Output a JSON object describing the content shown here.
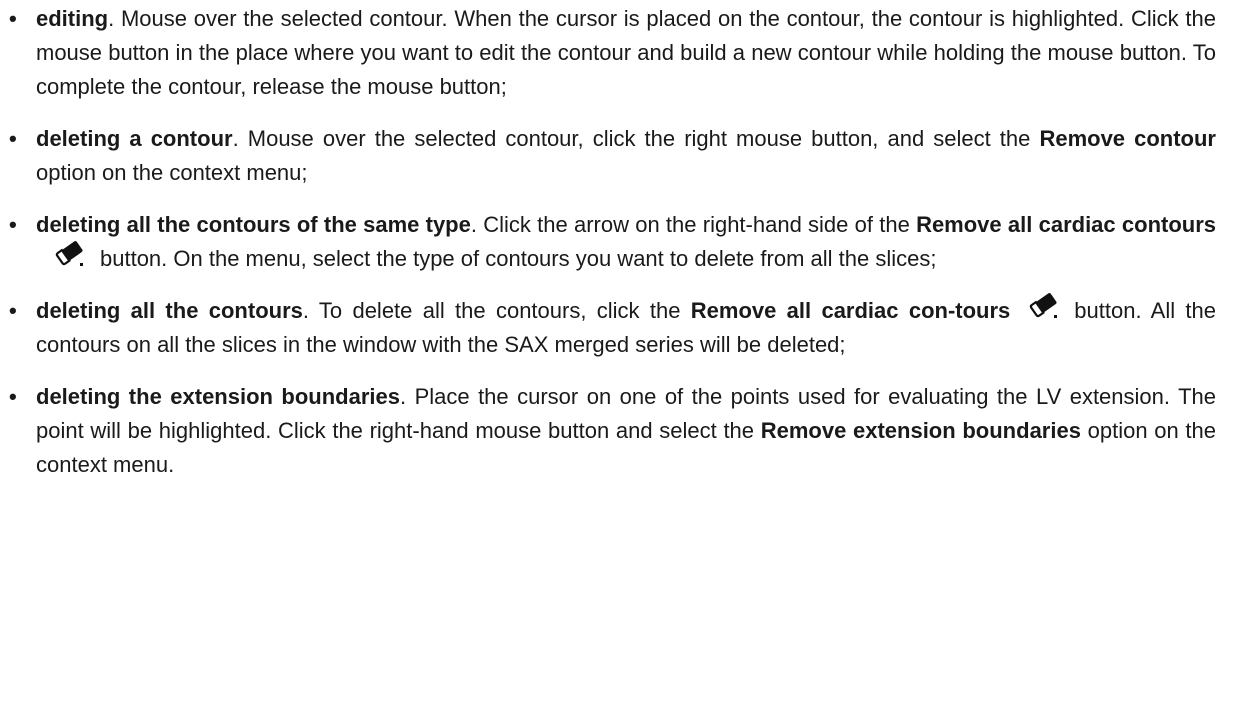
{
  "items": [
    {
      "term": "editing",
      "text": ". Mouse over the selected contour. When the cursor is placed on the contour, the contour is highlighted. Click the mouse button in the place where you want to edit the contour and build a new contour while holding the mouse button. To complete the contour, release the mouse button;"
    },
    {
      "term": "deleting a contour",
      "text_before": ". Mouse over the selected contour, click the right mouse button, and select the ",
      "option": "Remove contour",
      "text_after": " option on the context menu;"
    },
    {
      "term": "deleting all the contours of the same type",
      "text_before": ". Click the arrow on the right-hand side of the ",
      "button_name": "Remove all cardiac contours",
      "icon": "eraser-icon",
      "text_after": "button. On the menu, select the type of contours you want to delete from all the slices;"
    },
    {
      "term": "deleting all the contours",
      "text_before": ". To delete all the contours, click the ",
      "button_name": "Remove all cardiac con-tours",
      "icon": "eraser-icon",
      "text_after": "button. All the contours on all the slices in the window with the SAX merged series will be deleted;"
    },
    {
      "term": "deleting the extension boundaries",
      "text_before": ". Place the cursor on one of the points used for evaluating the LV extension. The point will be highlighted. Click the right-hand mouse button and select the ",
      "option": "Remove extension boundaries",
      "text_after": " option on the context menu."
    }
  ],
  "bullet_char": "•",
  "colors": {
    "text": "#1a1a1a",
    "icon": "#111111"
  }
}
